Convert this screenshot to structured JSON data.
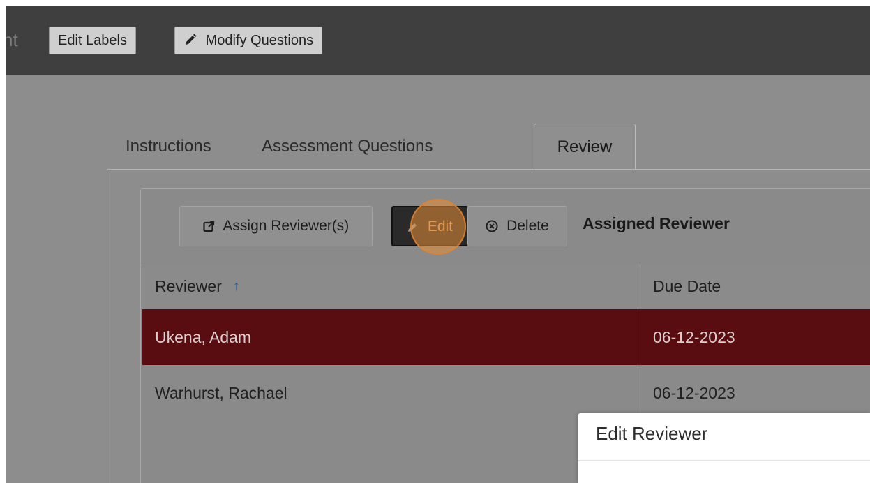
{
  "topbar": {
    "title_fragment": "nt",
    "edit_labels": "Edit Labels",
    "modify_questions": "Modify Questions"
  },
  "tabs": [
    {
      "label": "Instructions"
    },
    {
      "label": "Assessment Questions"
    },
    {
      "label": "Review"
    }
  ],
  "toolbar": {
    "assign_reviewers": "Assign Reviewer(s)",
    "edit": "Edit",
    "delete": "Delete",
    "section_title": "Assigned Reviewer"
  },
  "table": {
    "headers": [
      "Reviewer",
      "Due Date"
    ],
    "sort_indicator": "↑",
    "rows": [
      {
        "reviewer": "Ukena, Adam",
        "due_date": "06-12-2023"
      },
      {
        "reviewer": "Warhurst, Rachael",
        "due_date": "06-12-2023"
      }
    ]
  },
  "modal": {
    "title": "Edit Reviewer"
  },
  "colors": {
    "selected_row": "#5a0d10",
    "click_marker": "#e88e38",
    "sort_arrow": "#1c5c9c"
  }
}
